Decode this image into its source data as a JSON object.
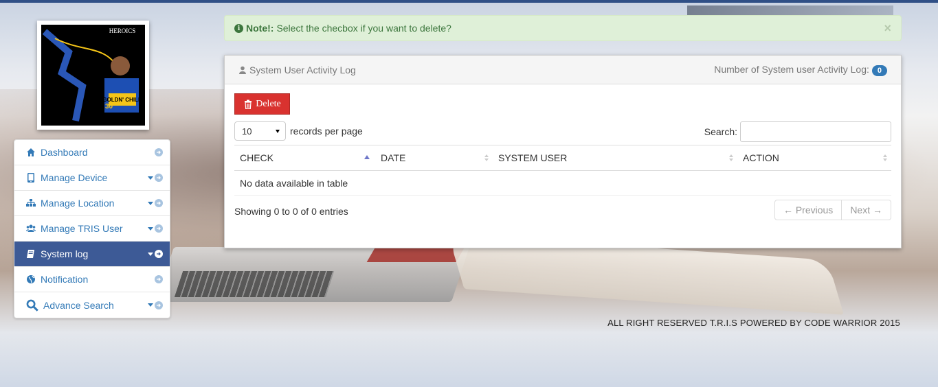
{
  "alert": {
    "icon": "info-circle-icon",
    "label": "Note!:",
    "message": "Select the checbox if you want to delete?",
    "close": "×"
  },
  "profile": {
    "brand": "HEROICS",
    "jersey_text": "GOLDN' CHILD",
    "number": "30"
  },
  "sidebar": {
    "items": [
      {
        "label": "Dashboard",
        "icon": "home-icon",
        "dropdown": false,
        "active": false
      },
      {
        "label": "Manage Device",
        "icon": "tablet-icon",
        "dropdown": true,
        "active": false
      },
      {
        "label": "Manage Location",
        "icon": "sitemap-icon",
        "dropdown": true,
        "active": false
      },
      {
        "label": "Manage TRIS User",
        "icon": "users-icon",
        "dropdown": true,
        "active": false
      },
      {
        "label": "System log",
        "icon": "book-icon",
        "dropdown": true,
        "active": true
      },
      {
        "label": "Notification",
        "icon": "globe-icon",
        "dropdown": false,
        "active": false
      },
      {
        "label": "Advance Search",
        "icon": "search-icon",
        "dropdown": true,
        "active": false
      }
    ]
  },
  "panel": {
    "title": "System User Activity Log",
    "count_label": "Number of System user Activity Log:",
    "count": "0",
    "delete_label": "Delete",
    "length_value": "10",
    "length_suffix": "records per page",
    "search_label": "Search:",
    "search_value": "",
    "columns": [
      "CHECK",
      "DATE",
      "SYSTEM USER",
      "ACTION"
    ],
    "empty_text": "No data available in table",
    "info": "Showing 0 to 0 of 0 entries",
    "prev": "← Previous",
    "next": "Next →"
  },
  "footer": {
    "text": "ALL RIGHT RESERVED T.R.I.S POWERED BY CODE WARRIOR 2015"
  },
  "colors": {
    "active_nav": "#3d5a96",
    "link": "#337ab7",
    "delete": "#d9322f",
    "alert_bg": "#dff0d8"
  }
}
